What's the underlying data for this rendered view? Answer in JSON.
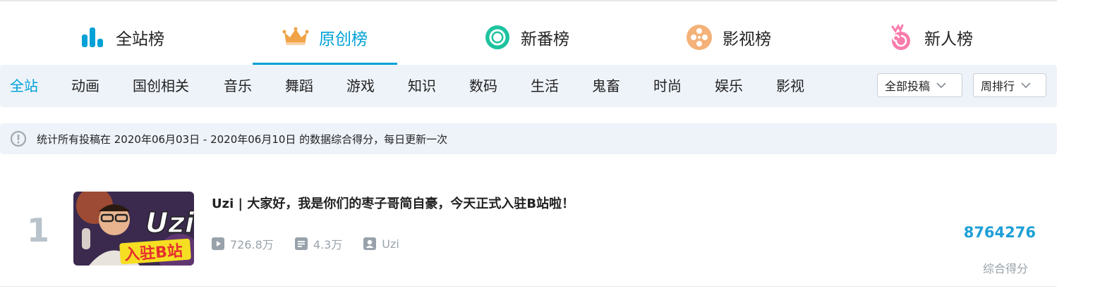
{
  "rank_tabs": [
    {
      "label": "全站榜",
      "icon": "bar-chart-icon",
      "color": "#00a1d6"
    },
    {
      "label": "原创榜",
      "icon": "crown-icon",
      "color": "#f0a347"
    },
    {
      "label": "新番榜",
      "icon": "circle-dot-icon",
      "color": "#1dc3a0"
    },
    {
      "label": "影视榜",
      "icon": "film-reel-icon",
      "color": "#f4b178"
    },
    {
      "label": "新人榜",
      "icon": "newbie-swirl-icon",
      "color": "#f97cac"
    }
  ],
  "categories": [
    "全站",
    "动画",
    "国创相关",
    "音乐",
    "舞蹈",
    "游戏",
    "知识",
    "数码",
    "生活",
    "鬼畜",
    "时尚",
    "娱乐",
    "影视"
  ],
  "filters": {
    "submission": "全部投稿",
    "period": "周排行"
  },
  "notice": "统计所有投稿在 2020年06月03日 - 2020年06月10日 的数据综合得分，每日更新一次",
  "item": {
    "rank": "1",
    "thumb_text": "Uzi",
    "thumb_badge": "入驻B站",
    "title": "Uzi | 大家好，我是你们的枣子哥简自豪，今天正式入驻B站啦！",
    "plays": "726.8万",
    "danmaku": "4.3万",
    "author": "Uzi",
    "score": "8764276",
    "score_label": "综合得分"
  },
  "colors": {
    "accent": "#00a1d6",
    "bar_bg": "#eef3fa",
    "muted": "#99a2aa"
  }
}
